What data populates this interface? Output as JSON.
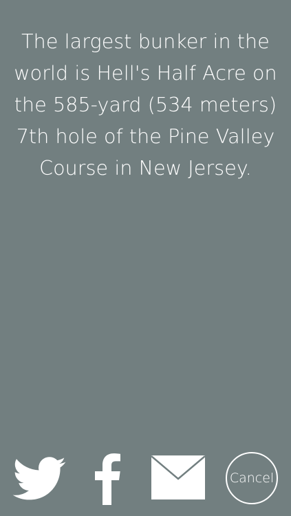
{
  "fact": {
    "text": "The largest bunker in the world is Hell's Half Acre on the 585-yard (534 meters) 7th hole of the Pine Valley Course in New Jersey."
  },
  "share": {
    "icons": [
      "twitter-icon",
      "facebook-icon",
      "mail-icon"
    ],
    "cancel_label": "Cancel"
  },
  "colors": {
    "background": "#727f80",
    "foreground": "#ffffff"
  }
}
